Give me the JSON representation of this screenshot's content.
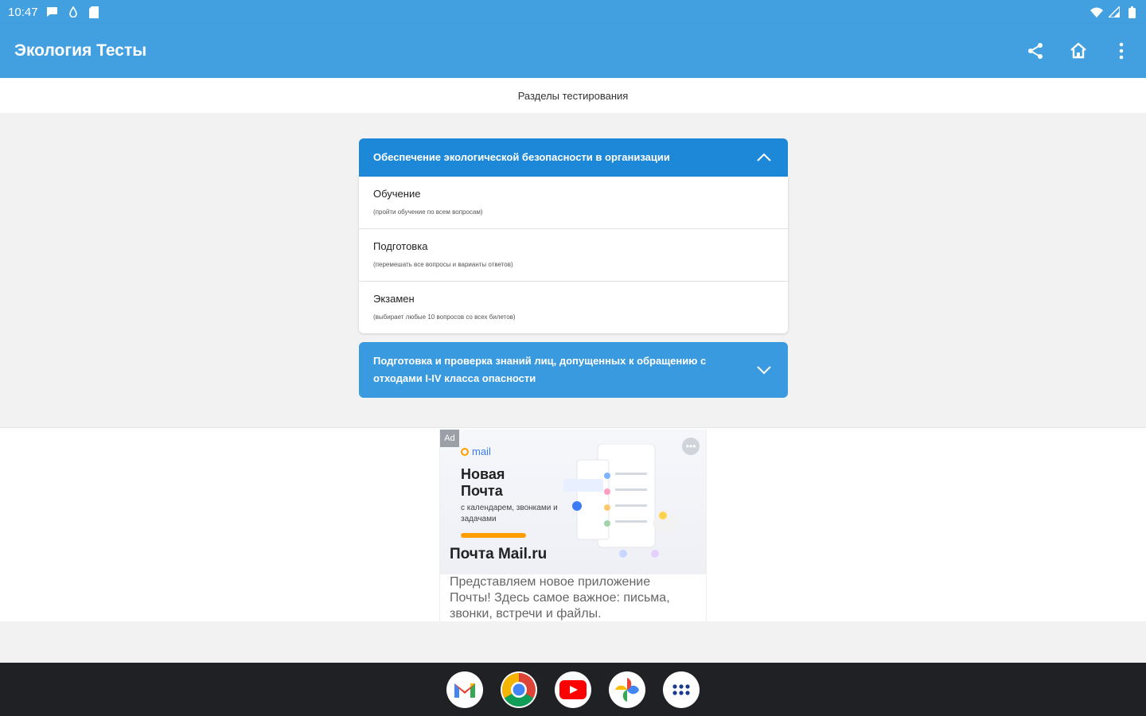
{
  "status": {
    "time": "10:47",
    "icons": [
      "chat-icon",
      "drop-icon",
      "sdcard-icon",
      "wifi-icon",
      "signal-icon",
      "battery-icon"
    ]
  },
  "appbar": {
    "title": "Экология Тесты",
    "actions": [
      "share-icon",
      "home-icon",
      "more-vert-icon"
    ]
  },
  "subtitle": "Разделы тестирования",
  "sections": [
    {
      "title": "Обеспечение экологической безопасности в организации",
      "expanded": true,
      "items": [
        {
          "name": "Обучение",
          "desc": "(пройти обучение по всем вопросам)"
        },
        {
          "name": "Подготовка",
          "desc": "(перемешать все вопросы и варианты ответов)"
        },
        {
          "name": "Экзамен",
          "desc": "(выбирает любые 10 вопросов со всех билетов)"
        }
      ]
    },
    {
      "title": "Подготовка и проверка знаний лиц, допущенных к обращению с отходами I-IV класса опасности",
      "expanded": false
    }
  ],
  "ad": {
    "badge": "Ad",
    "logo": "mail",
    "headline": "Новая Почта",
    "sub": "с календарем, звонками и задачами",
    "brand": "Почта Mail.ru",
    "text": "Представляем новое приложение Почты! Здесь самое важное: письма, звонки, встречи и файлы."
  },
  "dock": [
    "gmail-icon",
    "chrome-icon",
    "youtube-icon",
    "photos-icon",
    "app-drawer-icon"
  ],
  "colors": {
    "primary": "#42a0e0",
    "header_dark": "#1e88d8",
    "navbar": "#202124"
  }
}
